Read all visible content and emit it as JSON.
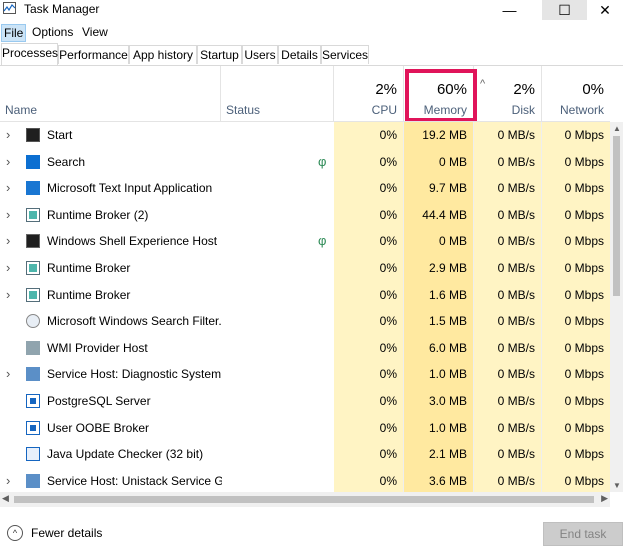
{
  "window": {
    "title": "Task Manager",
    "min_glyph": "—",
    "max_glyph": "☐",
    "close_glyph": "✕"
  },
  "menu": {
    "file": "File",
    "options": "Options",
    "view": "View"
  },
  "tabs": [
    {
      "label": "Processes",
      "active": true
    },
    {
      "label": "Performance"
    },
    {
      "label": "App history"
    },
    {
      "label": "Startup"
    },
    {
      "label": "Users"
    },
    {
      "label": "Details"
    },
    {
      "label": "Services"
    }
  ],
  "columns": {
    "name": {
      "label": "Name"
    },
    "status": {
      "label": "Status"
    },
    "cpu": {
      "pct": "2%",
      "label": "CPU"
    },
    "memory": {
      "pct": "60%",
      "label": "Memory"
    },
    "disk": {
      "pct": "2%",
      "label": "Disk"
    },
    "network": {
      "pct": "0%",
      "label": "Network"
    }
  },
  "sort_glyph": "^",
  "processes": [
    {
      "name": "Start",
      "cpu": "0%",
      "memory": "19.2 MB",
      "disk": "0 MB/s",
      "network": "0 Mbps",
      "expand": "›",
      "leaf": ""
    },
    {
      "name": "Search",
      "cpu": "0%",
      "memory": "0 MB",
      "disk": "0 MB/s",
      "network": "0 Mbps",
      "expand": "›",
      "leaf": "φ"
    },
    {
      "name": "Microsoft Text Input Application",
      "cpu": "0%",
      "memory": "9.7 MB",
      "disk": "0 MB/s",
      "network": "0 Mbps",
      "expand": "›",
      "leaf": ""
    },
    {
      "name": "Runtime Broker (2)",
      "cpu": "0%",
      "memory": "44.4 MB",
      "disk": "0 MB/s",
      "network": "0 Mbps",
      "expand": "›",
      "leaf": ""
    },
    {
      "name": "Windows Shell Experience Host",
      "cpu": "0%",
      "memory": "0 MB",
      "disk": "0 MB/s",
      "network": "0 Mbps",
      "expand": "›",
      "leaf": "φ"
    },
    {
      "name": "Runtime Broker",
      "cpu": "0%",
      "memory": "2.9 MB",
      "disk": "0 MB/s",
      "network": "0 Mbps",
      "expand": "›",
      "leaf": ""
    },
    {
      "name": "Runtime Broker",
      "cpu": "0%",
      "memory": "1.6 MB",
      "disk": "0 MB/s",
      "network": "0 Mbps",
      "expand": "›",
      "leaf": ""
    },
    {
      "name": "Microsoft Windows Search Filter...",
      "cpu": "0%",
      "memory": "1.5 MB",
      "disk": "0 MB/s",
      "network": "0 Mbps",
      "expand": "",
      "leaf": ""
    },
    {
      "name": "WMI Provider Host",
      "cpu": "0%",
      "memory": "6.0 MB",
      "disk": "0 MB/s",
      "network": "0 Mbps",
      "expand": "",
      "leaf": ""
    },
    {
      "name": "Service Host: Diagnostic System...",
      "cpu": "0%",
      "memory": "1.0 MB",
      "disk": "0 MB/s",
      "network": "0 Mbps",
      "expand": "›",
      "leaf": ""
    },
    {
      "name": "PostgreSQL Server",
      "cpu": "0%",
      "memory": "3.0 MB",
      "disk": "0 MB/s",
      "network": "0 Mbps",
      "expand": "",
      "leaf": ""
    },
    {
      "name": "User OOBE Broker",
      "cpu": "0%",
      "memory": "1.0 MB",
      "disk": "0 MB/s",
      "network": "0 Mbps",
      "expand": "",
      "leaf": ""
    },
    {
      "name": "Java Update Checker (32 bit)",
      "cpu": "0%",
      "memory": "2.1 MB",
      "disk": "0 MB/s",
      "network": "0 Mbps",
      "expand": "",
      "leaf": ""
    },
    {
      "name": "Service Host: Unistack Service G...",
      "cpu": "0%",
      "memory": "3.6 MB",
      "disk": "0 MB/s",
      "network": "0 Mbps",
      "expand": "›",
      "leaf": ""
    }
  ],
  "footer": {
    "fewer_details": "Fewer details",
    "fewer_glyph": "^",
    "end_task": "End task"
  },
  "colors": {
    "highlight_border": "#e0145a",
    "memory_heat": "#ffe9a0",
    "cpu_heat": "#fff4c4"
  }
}
